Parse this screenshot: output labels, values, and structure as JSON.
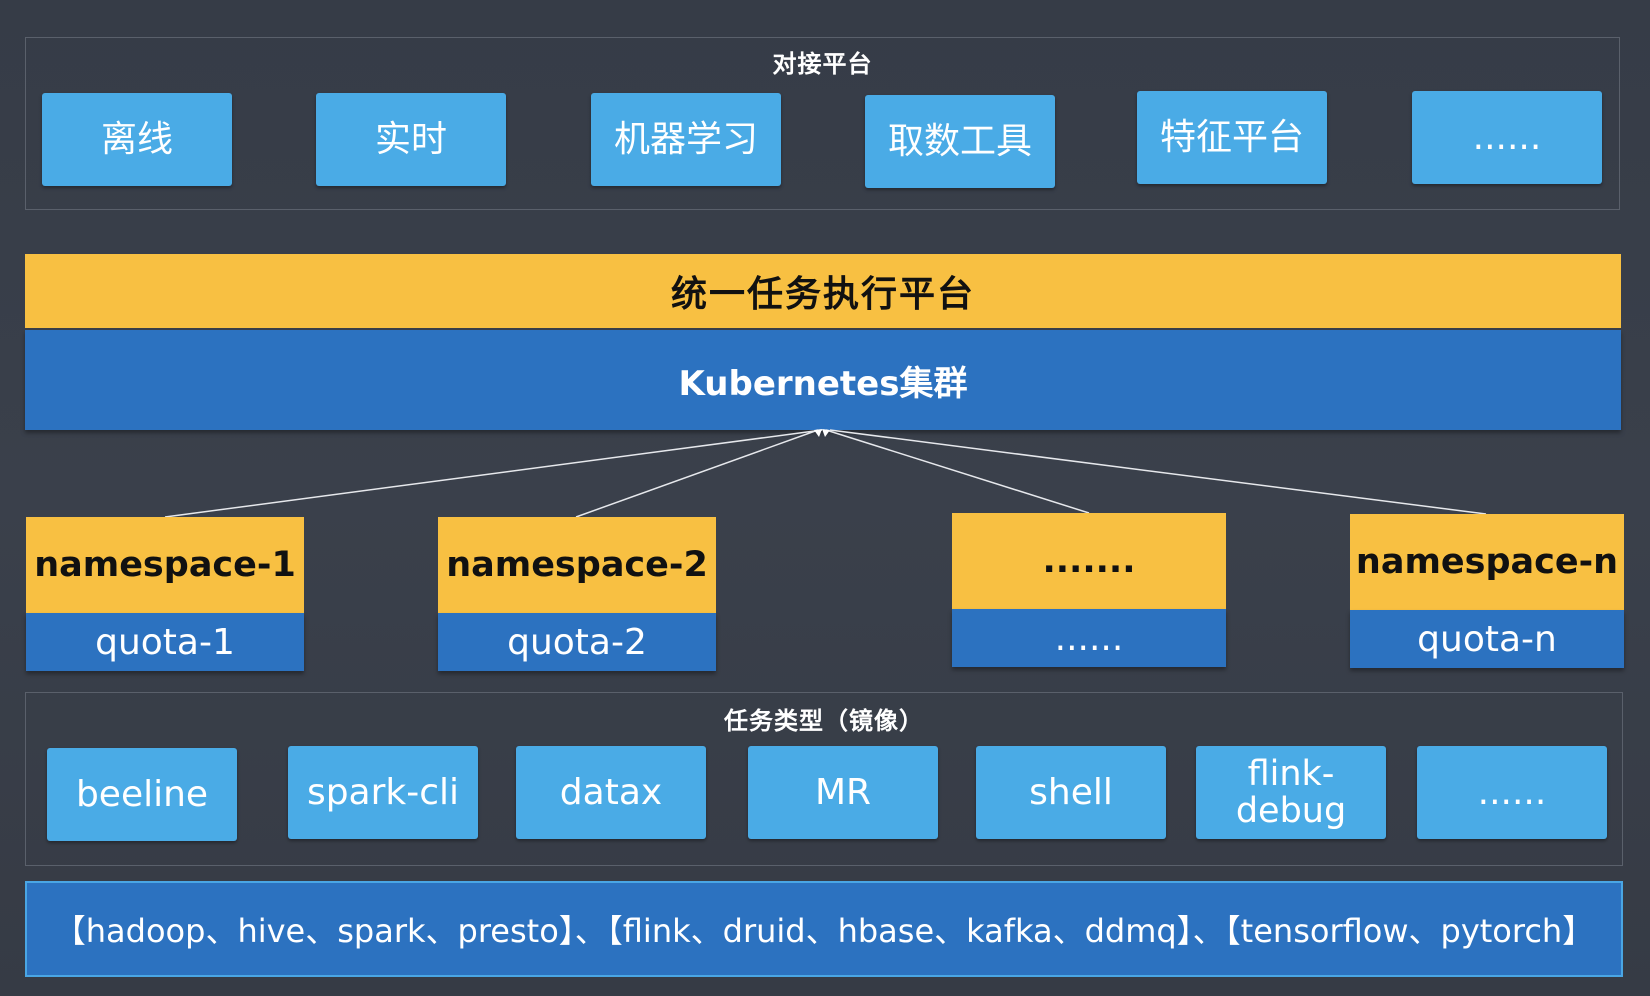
{
  "integration": {
    "title": "对接平台",
    "items": [
      "离线",
      "实时",
      "机器学习",
      "取数工具",
      "特征平台",
      "......"
    ]
  },
  "unified_platform": {
    "label": "统一任务执行平台"
  },
  "cluster": {
    "label": "Kubernetes集群"
  },
  "namespaces": [
    {
      "name": "namespace-1",
      "quota": "quota-1"
    },
    {
      "name": "namespace-2",
      "quota": "quota-2"
    },
    {
      "name": ".......",
      "quota": "......"
    },
    {
      "name": "namespace-n",
      "quota": "quota-n"
    }
  ],
  "task_types": {
    "title": "任务类型（镜像）",
    "items": [
      "beeline",
      "spark-cli",
      "datax",
      "MR",
      "shell",
      "flink-debug",
      "......"
    ]
  },
  "base_components": {
    "text": "【hadoop、hive、spark、presto】、【flink、druid、hbase、kafka、ddmq】、【tensorflow、pytorch】"
  },
  "colors": {
    "background": "#373d48",
    "chip": "#4aabe6",
    "yellow": "#f8c042",
    "blue": "#2c72c0"
  }
}
